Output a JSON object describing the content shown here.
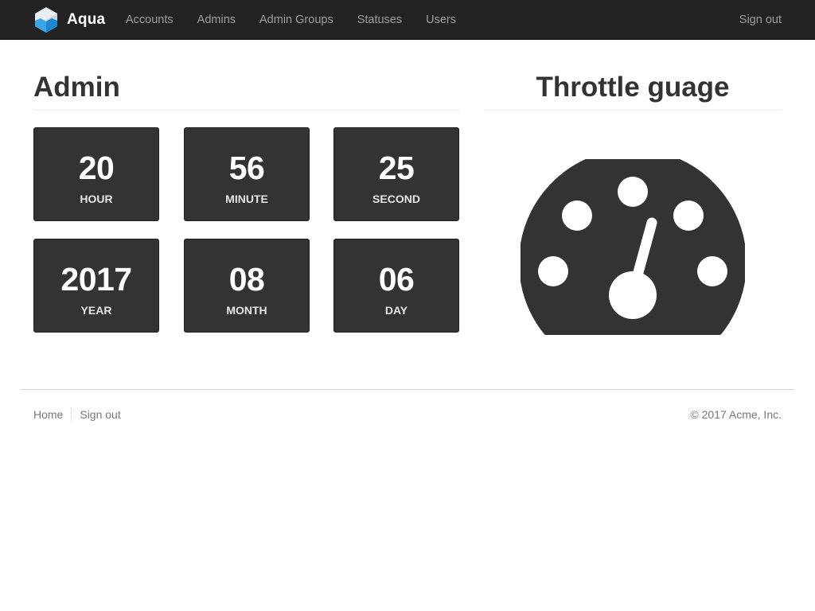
{
  "navbar": {
    "brand": {
      "name": "Aqua",
      "icon": "aqua-cube-logo",
      "logo_color": "#3aa6e8"
    },
    "items": [
      {
        "label": "Accounts"
      },
      {
        "label": "Admins"
      },
      {
        "label": "Admin Groups"
      },
      {
        "label": "Statuses"
      },
      {
        "label": "Users"
      }
    ],
    "sign_out": "Sign out"
  },
  "admin": {
    "title": "Admin",
    "tiles": [
      {
        "value": "20",
        "label": "HOUR"
      },
      {
        "value": "56",
        "label": "MINUTE"
      },
      {
        "value": "25",
        "label": "SECOND"
      },
      {
        "value": "2017",
        "label": "YEAR"
      },
      {
        "value": "08",
        "label": "MONTH"
      },
      {
        "value": "06",
        "label": "DAY"
      }
    ]
  },
  "throttle": {
    "title": "Throttle guage",
    "icon": "dashboard-gauge-icon",
    "color": "#333333"
  },
  "footer": {
    "links": [
      {
        "label": "Home"
      },
      {
        "label": "Sign out"
      }
    ],
    "copyright": "© 2017 Acme, Inc."
  }
}
